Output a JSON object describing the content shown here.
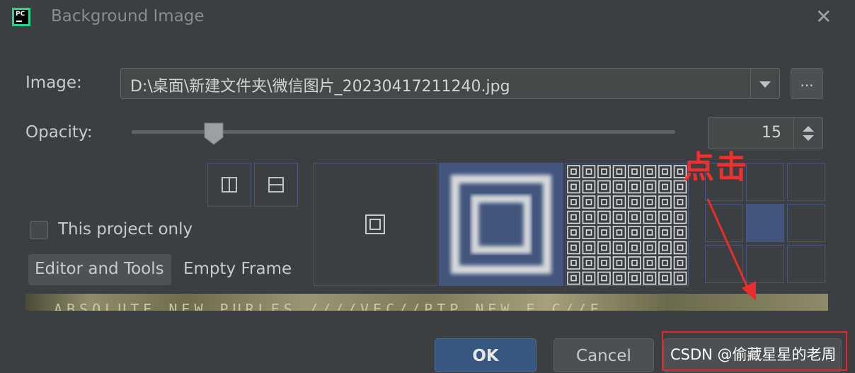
{
  "window": {
    "title": "Background Image",
    "app_icon": "PC"
  },
  "image_field": {
    "label": "Image:",
    "value": "D:\\桌面\\新建文件夹\\微信图片_20230417211240.jpg",
    "browse_label": "..."
  },
  "opacity": {
    "label": "Opacity:",
    "value": "15",
    "slider_fraction": 0.15
  },
  "checkbox": {
    "label": "This project only",
    "checked": false
  },
  "target_tabs": {
    "editor_and_tools": "Editor and Tools",
    "empty_frame": "Empty Frame"
  },
  "preview_text": "ABSOLUTE_NEW  PURLES  ////VEC//PTP_NEW  E  C//E",
  "buttons": {
    "ok": "OK",
    "cancel": "Cancel"
  },
  "annotation": {
    "text": "点击",
    "color": "#f0302f"
  },
  "watermark": "CSDN @偷藏星星的老周",
  "colors": {
    "accent": "#365880",
    "selection": "#41557d",
    "annotation_red": "#e8242c"
  }
}
